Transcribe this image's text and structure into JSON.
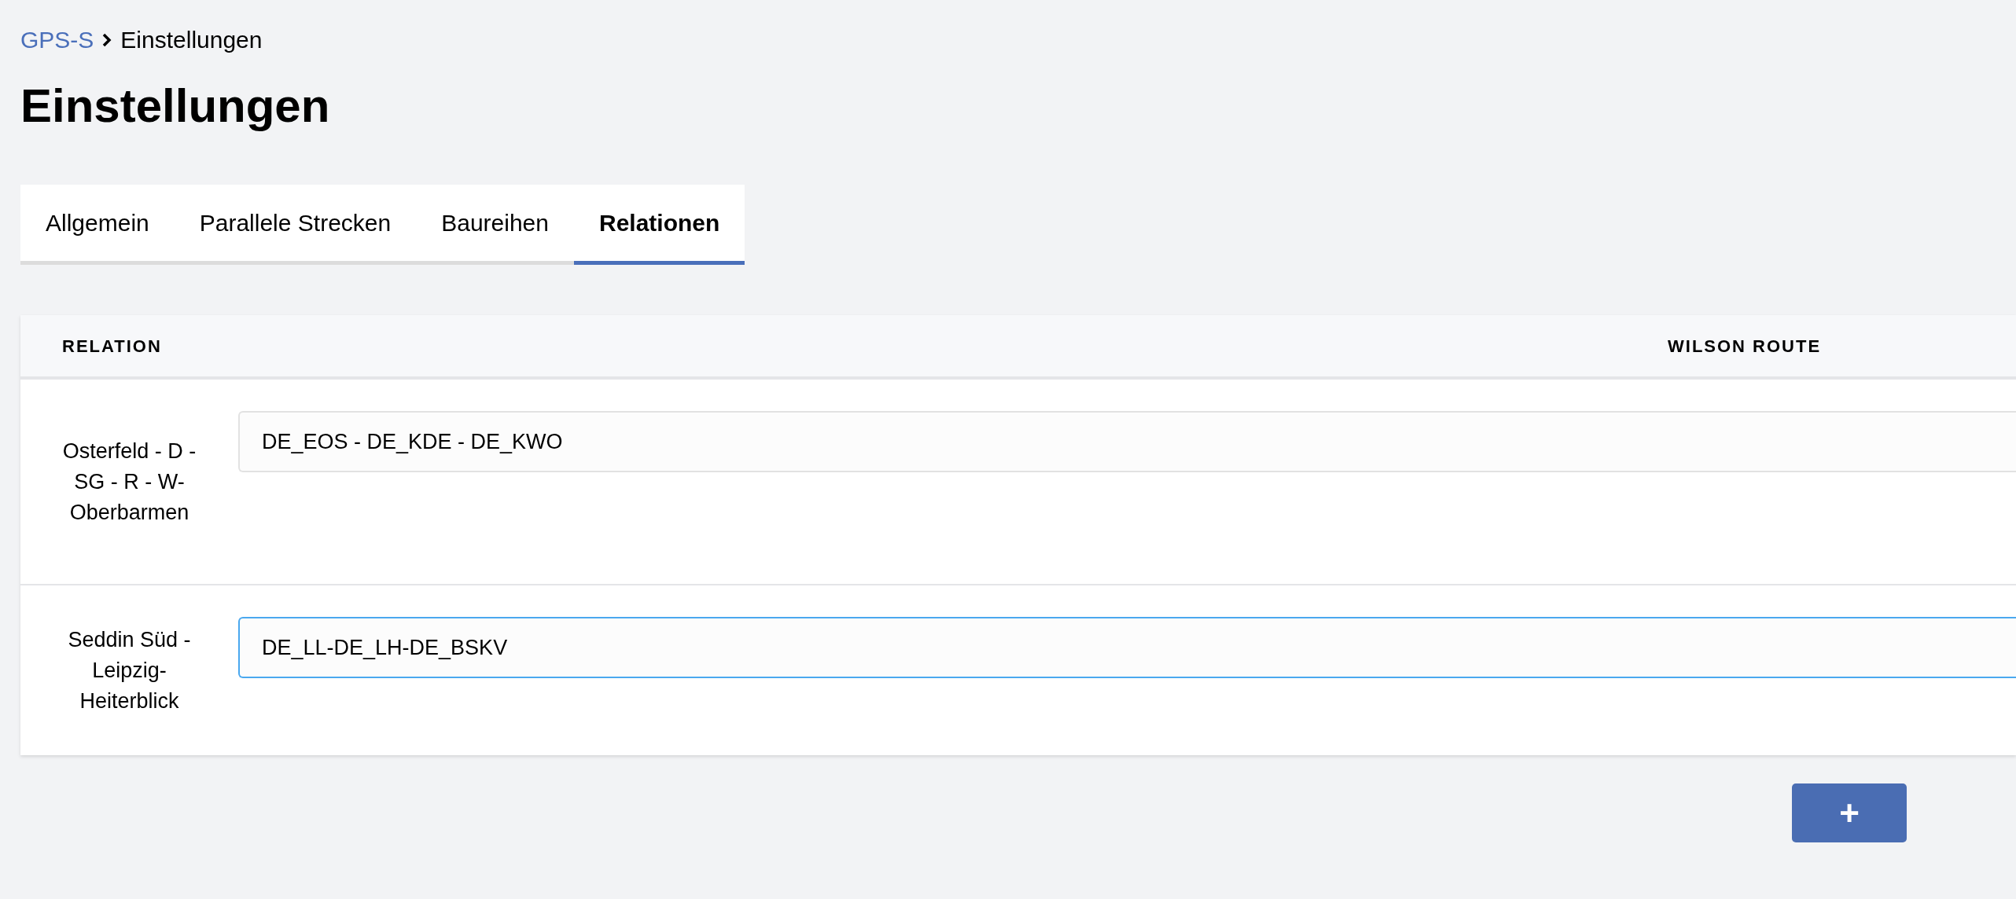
{
  "breadcrumb": [
    {
      "label": "GPS-S",
      "kind": "link"
    },
    {
      "label": "Einstellungen",
      "kind": "current"
    }
  ],
  "title": "Einstellungen",
  "tabs": [
    {
      "label": "Allgemein",
      "selected": false
    },
    {
      "label": "Parallele Strecken",
      "selected": false
    },
    {
      "label": "Baureihen",
      "selected": false
    },
    {
      "label": "Relationen",
      "selected": true
    }
  ],
  "table": {
    "columns": [
      "RELATION",
      "WILSON ROUTE"
    ],
    "rows": [
      {
        "relation": "Osterfeld - D - SG - R - W- Oberbarmen",
        "route": "DE_EOS - DE_KDE - DE_KWO",
        "focused": false
      },
      {
        "relation": "Seddin Süd - Leipzig-Heiterblick",
        "route": "DE_LL-DE_LH-DE_BSKV",
        "focused": true
      }
    ]
  },
  "add_button": {
    "label": "+"
  }
}
